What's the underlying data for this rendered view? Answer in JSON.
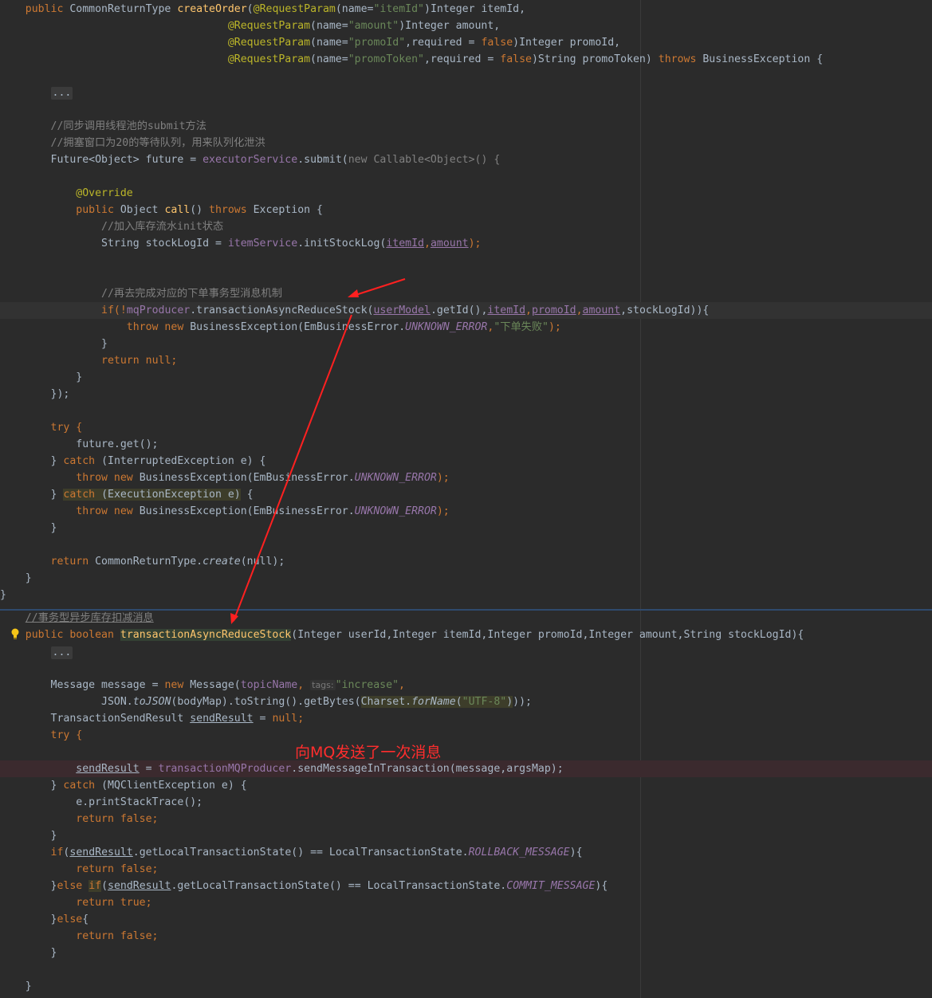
{
  "code": {
    "l1_a": "public ",
    "l1_b": "CommonReturnType ",
    "l1_c": "createOrder",
    "l1_d": "(",
    "ann_reqparam": "@RequestParam",
    "name_eq": "(name=",
    "p_itemId": "\"itemId\"",
    "p_itemId_type": ")Integer itemId,",
    "p_amount": "\"amount\"",
    "p_amount_type": ")Integer amount,",
    "p_promoId": "\"promoId\"",
    "req_false": ",required = ",
    "false": "false",
    "p_promoId_type": ")Integer promoId,",
    "p_promoToken": "\"promoToken\"",
    "p_promoToken_type": ")String promoToken) ",
    "throws": "throws",
    "biz_exc_open": " BusinessException {",
    "fold_dots": "...",
    "cm_submit": "//同步调用线程池的submit方法",
    "cm_queue": "//拥塞窗口为20的等待队列，用来队列化泄洪",
    "future_a": "Future<Object> future = ",
    "executorService": "executorService",
    "submit_a": ".submit(",
    "new_callable": "new Callable<Object>() {",
    "override": "@Override",
    "call_public": "public ",
    "call_object": "Object ",
    "call_name": "call",
    "call_paren": "() ",
    "call_throws": "throws",
    "call_exc": " Exception {",
    "cm_initlog": "//加入库存流水init状态",
    "stocklog_a": "String stockLogId = ",
    "itemService": "itemService",
    "initStockLog": ".initStockLog(",
    "itemId": "itemId",
    "comma": ",",
    "amount": "amount",
    "close_semi": ");",
    "cm_mq": "//再去完成对应的下单事务型消息机制",
    "if_open": "if(!",
    "mqProducer": "mqProducer",
    "tars": ".transactionAsyncReduceStock(",
    "userModel": "userModel",
    "getId": ".getId(),",
    "promoId": "promoId",
    "stockLogId_close": ",stockLogId)){",
    "throw_new": "throw new ",
    "biz_exc": "BusinessException(EmBusinessError.",
    "unknown_error": "UNKNOWN_ERROR",
    "fail_msg": "\"下单失败\"",
    "close_paren_semi": ");",
    "rbrace": "}",
    "return_null": "return null;",
    "return_kw": "return ",
    "null_kw": "null",
    "semi": ";",
    "rbrace_paren": "});",
    "try_open": "try {",
    "future_get": "future.get();",
    "catch_kw": "catch ",
    "interrupted": "(InterruptedException e) {",
    "execution": "(ExecutionException e)",
    "exec_brace": " {",
    "rbrace_sp": "} ",
    "ret_create_a": "CommonReturnType.",
    "create": "create",
    "ret_create_b": "(null);",
    "cm_tx": "//事务型异步库存扣减消息",
    "m_public": "public ",
    "m_boolean": "boolean ",
    "m_name": "transactionAsyncReduceStock",
    "m_params": "(Integer userId,Integer itemId,Integer promoId,Integer amount,String stockLogId){",
    "msg_a": "Message message = ",
    "msg_new": "new ",
    "msg_b": "Message(",
    "topicName": "topicName",
    "tags_hint": "tags:",
    "increase": "\"increase\"",
    "comma_sp": ",",
    "json_a": "JSON.",
    "toJSON": "toJSON",
    "json_b": "(bodyMap).toString().getBytes(",
    "charset": "Charset.",
    "forName": "forName",
    "utf8": "\"UTF-8\"",
    "json_c": "));",
    "tsr_a": "TransactionSendResult ",
    "sendResult": "sendResult",
    "tsr_b": " = ",
    "tsr_null": "null",
    "tsr_semi": ";",
    "send_eq": " = ",
    "txProducer": "transactionMQProducer",
    "send_b": ".sendMessageInTransaction(message,argsMap);",
    "catch_mq": "(MQClientException e) {",
    "print_stack": "e.printStackTrace();",
    "return_false": "return false;",
    "return_true": "return true;",
    "if_kw": "if",
    "paren_open": "(",
    "get_state": ".getLocalTransactionState() == LocalTransactionState.",
    "rollback": "ROLLBACK_MESSAGE",
    "commit": "COMMIT_MESSAGE",
    "brace_close_open": "){",
    "else_kw": "else",
    "else_if_sp": " ",
    "else_brace": "{",
    "rbrace_only": "}"
  },
  "annotation": {
    "text": "向MQ发送了一次消息",
    "color": "#ff2d2d"
  },
  "colors": {
    "background": "#2b2b2b",
    "keyword": "#cc7832",
    "annotation": "#bbb529",
    "string": "#6a8759",
    "method_decl": "#ffc66d",
    "comment": "#808080",
    "field": "#9876aa"
  },
  "icons": {
    "intention": "lightbulb-icon"
  }
}
